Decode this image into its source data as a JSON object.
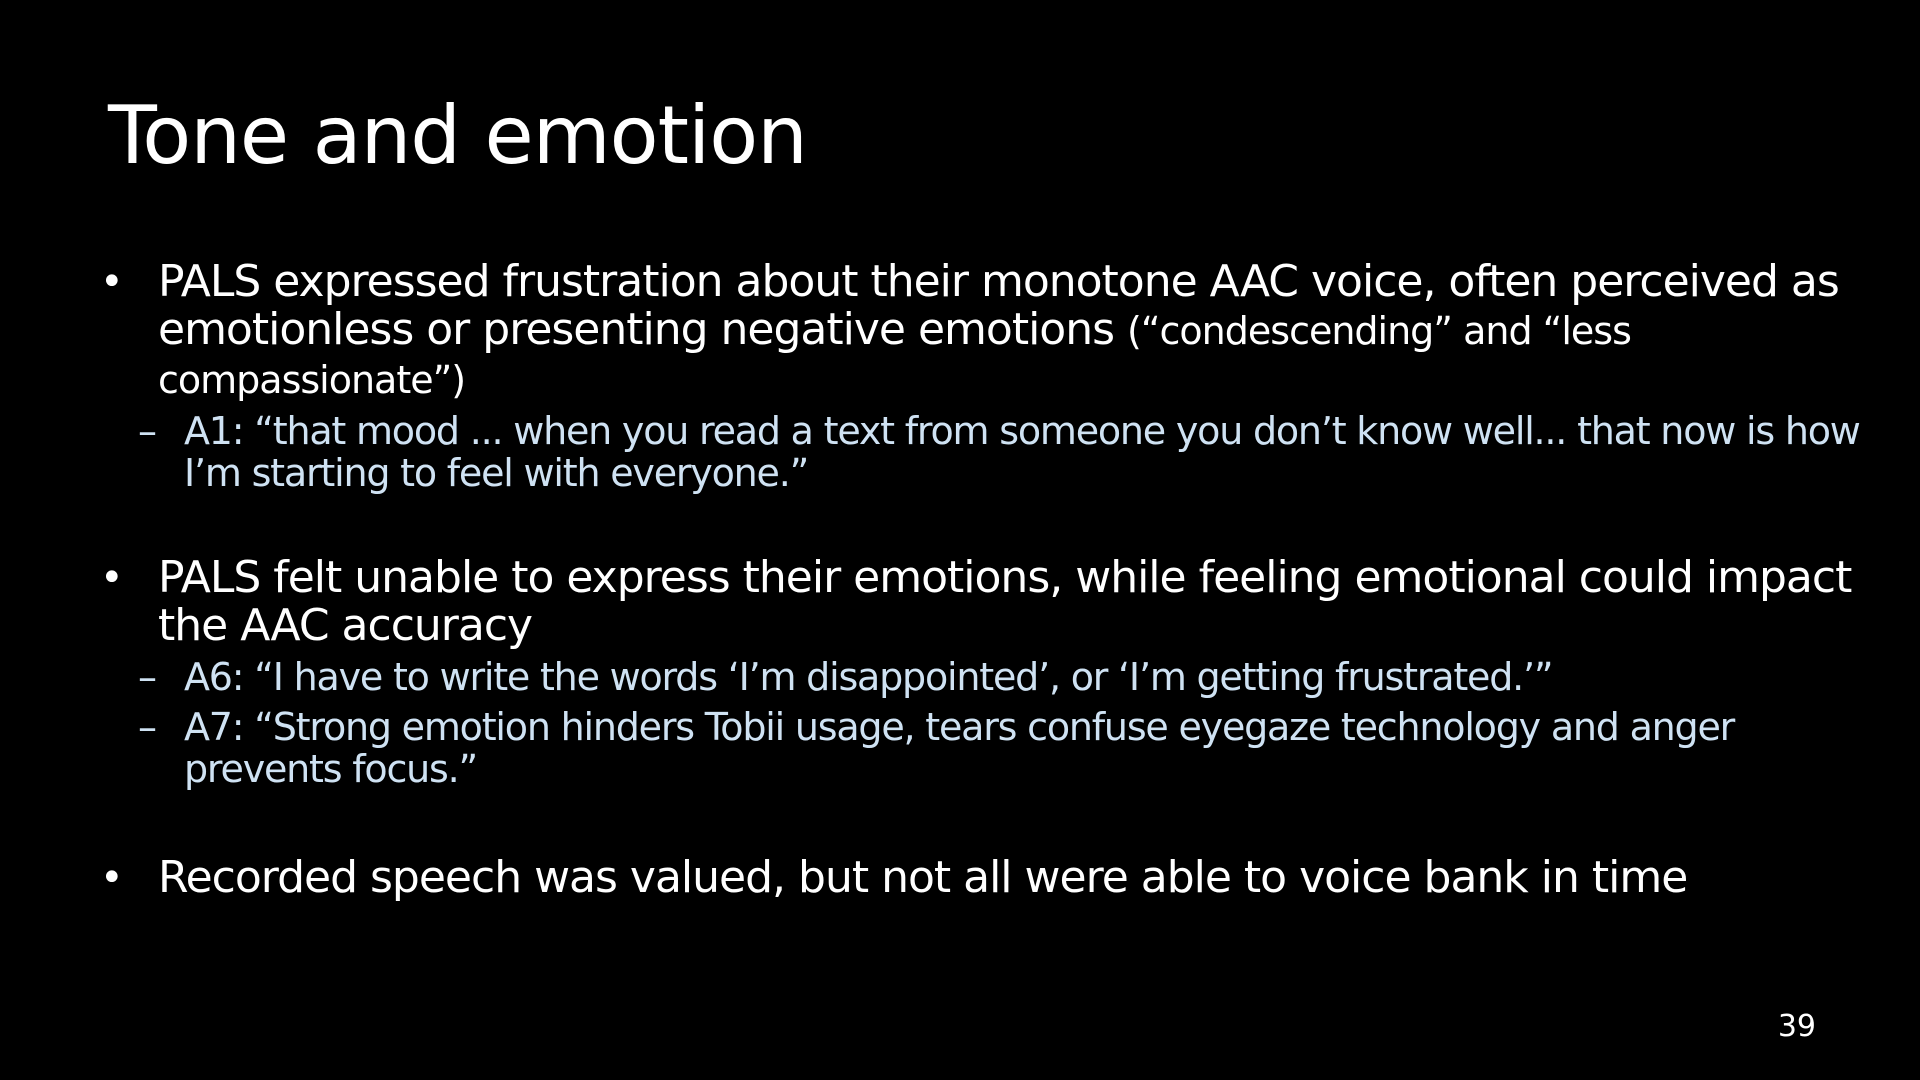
{
  "slide": {
    "title": "Tone and emotion",
    "page_number": "39",
    "colors": {
      "background": "#000000",
      "text": "#ffffff",
      "quote_text": "#cfe2f3"
    },
    "bullets": [
      {
        "text": "PALS expressed frustration about their monotone AAC voice, often perceived as emotionless or presenting negative emotions",
        "aside": "(“condescending” and “less compassionate”)",
        "subpoints": [
          "A1: “that mood ... when you read a text from someone you don’t know well... that now is how I’m starting to feel with everyone.”"
        ]
      },
      {
        "text": "PALS felt unable to express their emotions, while feeling emotional could impact the AAC accuracy",
        "subpoints": [
          "A6: “I have to write the words ‘I’m disappointed’, or ‘I’m getting frustrated.’”",
          "A7: “Strong emotion hinders Tobii usage, tears confuse eyegaze technology and anger prevents focus.”"
        ]
      },
      {
        "text": "Recorded speech was valued, but not all were able to voice bank in time"
      }
    ]
  }
}
